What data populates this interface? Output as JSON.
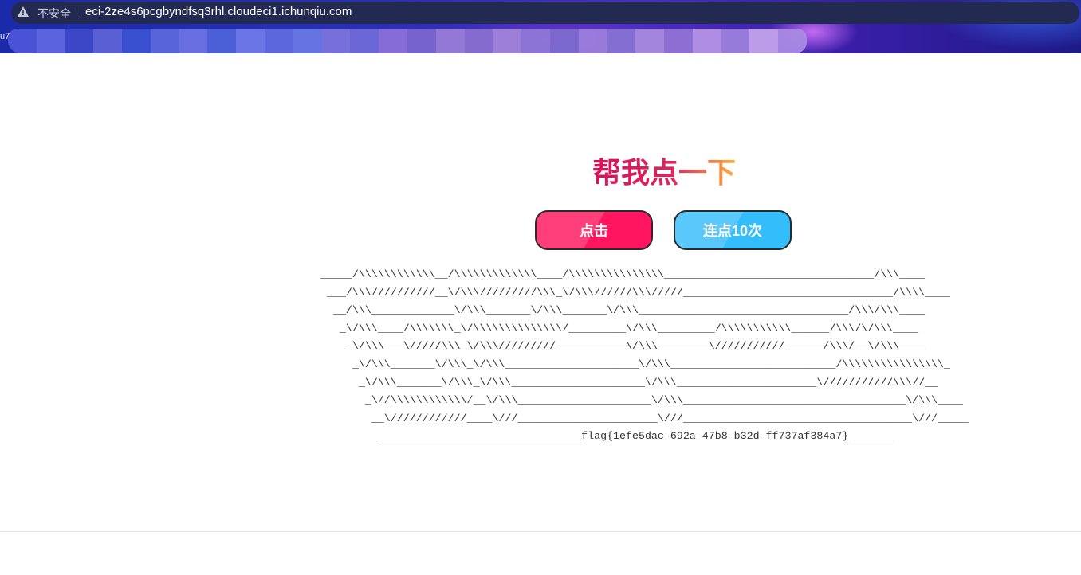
{
  "browser": {
    "security_label": "不安全",
    "url": "eci-2ze4s6pcgbyndfsq3rhl.cloudeci1.ichunqiu.com",
    "warning_icon": "warning-triangle-icon",
    "bookmark_fragment": "u7"
  },
  "page": {
    "title": "帮我点一下",
    "buttons": {
      "click_label": "点击",
      "click10_label": "连点10次"
    },
    "ascii_lines": [
      "_____/\\\\\\\\\\\\\\\\\\\\\\\\__/\\\\\\\\\\\\\\\\\\\\\\\\\\____/\\\\\\\\\\\\\\\\\\\\\\\\\\\\\\_________________________________/\\\\\\____",
      " ___/\\\\\\//////////__\\/\\\\\\/////////\\\\\\_\\/\\\\\\//////\\\\\\/////_________________________________/\\\\\\\\____",
      "  __/\\\\\\_____________\\/\\\\\\_______\\/\\\\\\_______\\/\\\\\\_________________________________/\\\\\\/\\\\\\____",
      "   _\\/\\\\\\____/\\\\\\\\\\\\\\_\\/\\\\\\\\\\\\\\\\\\\\\\\\\\\\/_________\\/\\\\\\_________/\\\\\\\\\\\\\\\\\\\\\\______/\\\\\\/\\/\\\\\\____",
      "    _\\/\\\\\\___\\/////\\\\\\_\\/\\\\\\/////////___________\\/\\\\\\________\\///////////______/\\\\\\/__\\/\\\\\\____",
      "     _\\/\\\\\\_______\\/\\\\\\_\\/\\\\\\_____________________\\/\\\\\\__________________________/\\\\\\\\\\\\\\\\\\\\\\\\\\\\\\\\_",
      "      _\\/\\\\\\_______\\/\\\\\\_\\/\\\\\\_____________________\\/\\\\\\______________________\\///////////\\\\\\//__",
      "       _\\//\\\\\\\\\\\\\\\\\\\\\\\\/__\\/\\\\\\_____________________\\/\\\\\\___________________________________\\/\\\\\\____",
      "        __\\////////////____\\///______________________\\///____________________________________\\///_____",
      "         ________________________________flag{1efe5dac-692a-47b8-b32d-ff737af384a7}_______"
    ]
  },
  "colors": {
    "title_gradient_start": "#d4145a",
    "title_gradient_end": "#fbb03b",
    "click_button": "#ff1560",
    "click10_button": "#33bdfb"
  }
}
